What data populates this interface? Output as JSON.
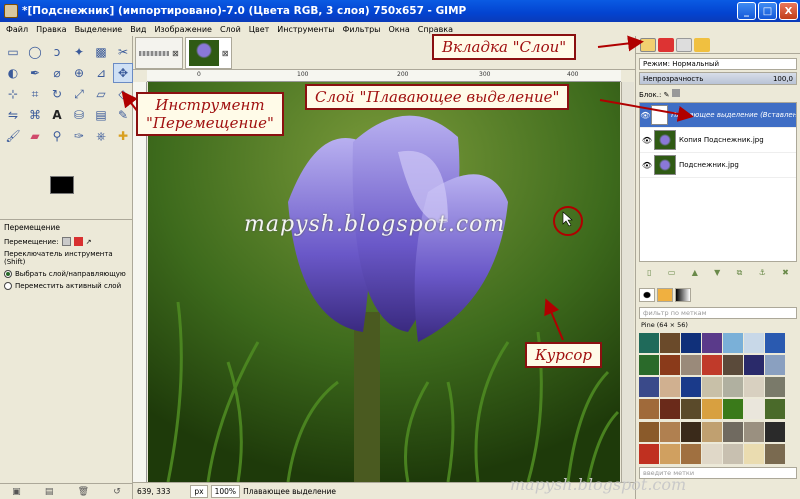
{
  "window": {
    "title": "*[Подснежник] (импортировано)-7.0 (Цвета RGB, 3 слоя) 750x657 - GIMP",
    "btn_min": "_",
    "btn_max": "□",
    "btn_close": "X"
  },
  "menu": [
    "Файл",
    "Правка",
    "Выделение",
    "Вид",
    "Изображение",
    "Слой",
    "Цвет",
    "Инструменты",
    "Фильтры",
    "Окна",
    "Справка"
  ],
  "tool_options": {
    "title": "Перемещение",
    "move_label": "Перемещение:",
    "switch_label": "Переключатель инструмента  (Shift)",
    "radio1": "Выбрать слой/направляющую",
    "radio2": "Переместить активный слой"
  },
  "ruler": {
    "ticks": [
      "0",
      "100",
      "200",
      "300",
      "400",
      "500"
    ]
  },
  "canvas": {
    "watermark": "mapysh.blogspot.com"
  },
  "status": {
    "coords": "639, 333",
    "unit": "px",
    "zoom": "100%",
    "layer": "Плавающее выделение"
  },
  "layers_panel": {
    "mode_label": "Режим: Нормальный",
    "opacity_label": "Непрозрачность",
    "opacity_value": "100,0",
    "lock_label": "Блок.:",
    "layers": [
      {
        "name": "Плавающее выделение (Вставленный слой)",
        "selected": true
      },
      {
        "name": "Копия Подснежник.jpg",
        "selected": false
      },
      {
        "name": "Подснежник.jpg",
        "selected": false
      }
    ]
  },
  "patterns_panel": {
    "filter_placeholder": "фильтр по меткам",
    "pattern_name": "Pine (64 × 56)",
    "tag_placeholder": "введите метки"
  },
  "callouts": {
    "tab_layers": "Вкладка \"Слои\"",
    "floating": "Слой \"Плавающее выделение\"",
    "move_tool_line1": "Инструмент",
    "move_tool_line2": "\"Перемещение\"",
    "cursor": "Курсор"
  },
  "watermark": "mapysh.blogspot.com",
  "colors": {
    "accent": "#8b1010",
    "selected": "#3f6ec5"
  }
}
